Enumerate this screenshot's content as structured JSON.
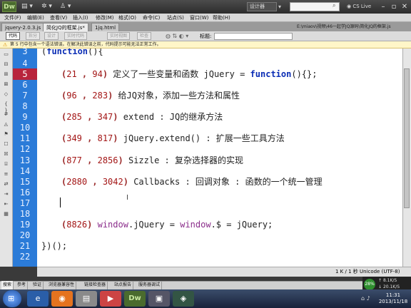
{
  "app": {
    "logo": "Dw",
    "workspace": "设计器",
    "cs_live": "CS Live"
  },
  "menu": [
    "文件(F)",
    "编辑(E)",
    "查看(V)",
    "插入(I)",
    "修改(M)",
    "格式(O)",
    "命令(C)",
    "站点(S)",
    "窗口(W)",
    "帮助(H)"
  ],
  "tabs": [
    {
      "label": "jquery-2.0.3.js"
    },
    {
      "label": "简化JQ的框架.js*"
    },
    {
      "label": "1jq.html"
    }
  ],
  "path": "E:\\miaov\\视频\\46一起学JQ源码\\简化JQ的框架.js",
  "toolbar": {
    "buttons": [
      "代码",
      "拆分",
      "设计",
      "实时代码",
      "实时视图",
      "检查"
    ],
    "title_label": "标题:"
  },
  "warning": "第 5 行中包含一个语法错误。在解决此错误之前，代码提示可能无法正常工作。",
  "editor": {
    "line_numbers": [
      "3",
      "4",
      "5",
      "6",
      "7",
      "8",
      "9",
      "10",
      "11",
      "12",
      "13",
      "14",
      "15",
      "16",
      "17",
      "18",
      "19",
      "20",
      "21",
      "22"
    ],
    "error_line": "5",
    "lines": [
      "(function(){",
      "",
      "(21 , 94) 定义了一些变量和函数 jQuery = function(){};",
      "",
      "(96 , 283) 给JQ对象，添加一些方法和属性",
      "",
      "(285 , 347) extend : JQ的继承方法",
      "",
      "(349 , 817) jQuery.extend() : 扩展一些工具方法",
      "",
      "(877 , 2856) Sizzle : 复杂选择器的实现",
      "",
      "(2880 , 3042) Callbacks : 回调对象 : 函数的一个统一管理",
      "",
      "",
      "",
      "(8826) window.jQuery = window.$ = jQuery;",
      "",
      "})();",
      ""
    ]
  },
  "status": "1 K / 1 秒 Unicode (UTF-8)",
  "network": {
    "percent": "28%",
    "up": "8.1K/S",
    "down": "20.1K/S"
  },
  "bottom_tabs": [
    "搜索",
    "参考",
    "验证",
    "浏览器兼容性",
    "链接检查器",
    "站点报告",
    "服务器调试"
  ],
  "clock": {
    "time": "11:31",
    "date": "2013/11/18"
  },
  "colors": {
    "gutter": "#2b7bd8",
    "error_line": "#b8243c",
    "keyword": "#0b2db5",
    "number": "#a31515"
  }
}
